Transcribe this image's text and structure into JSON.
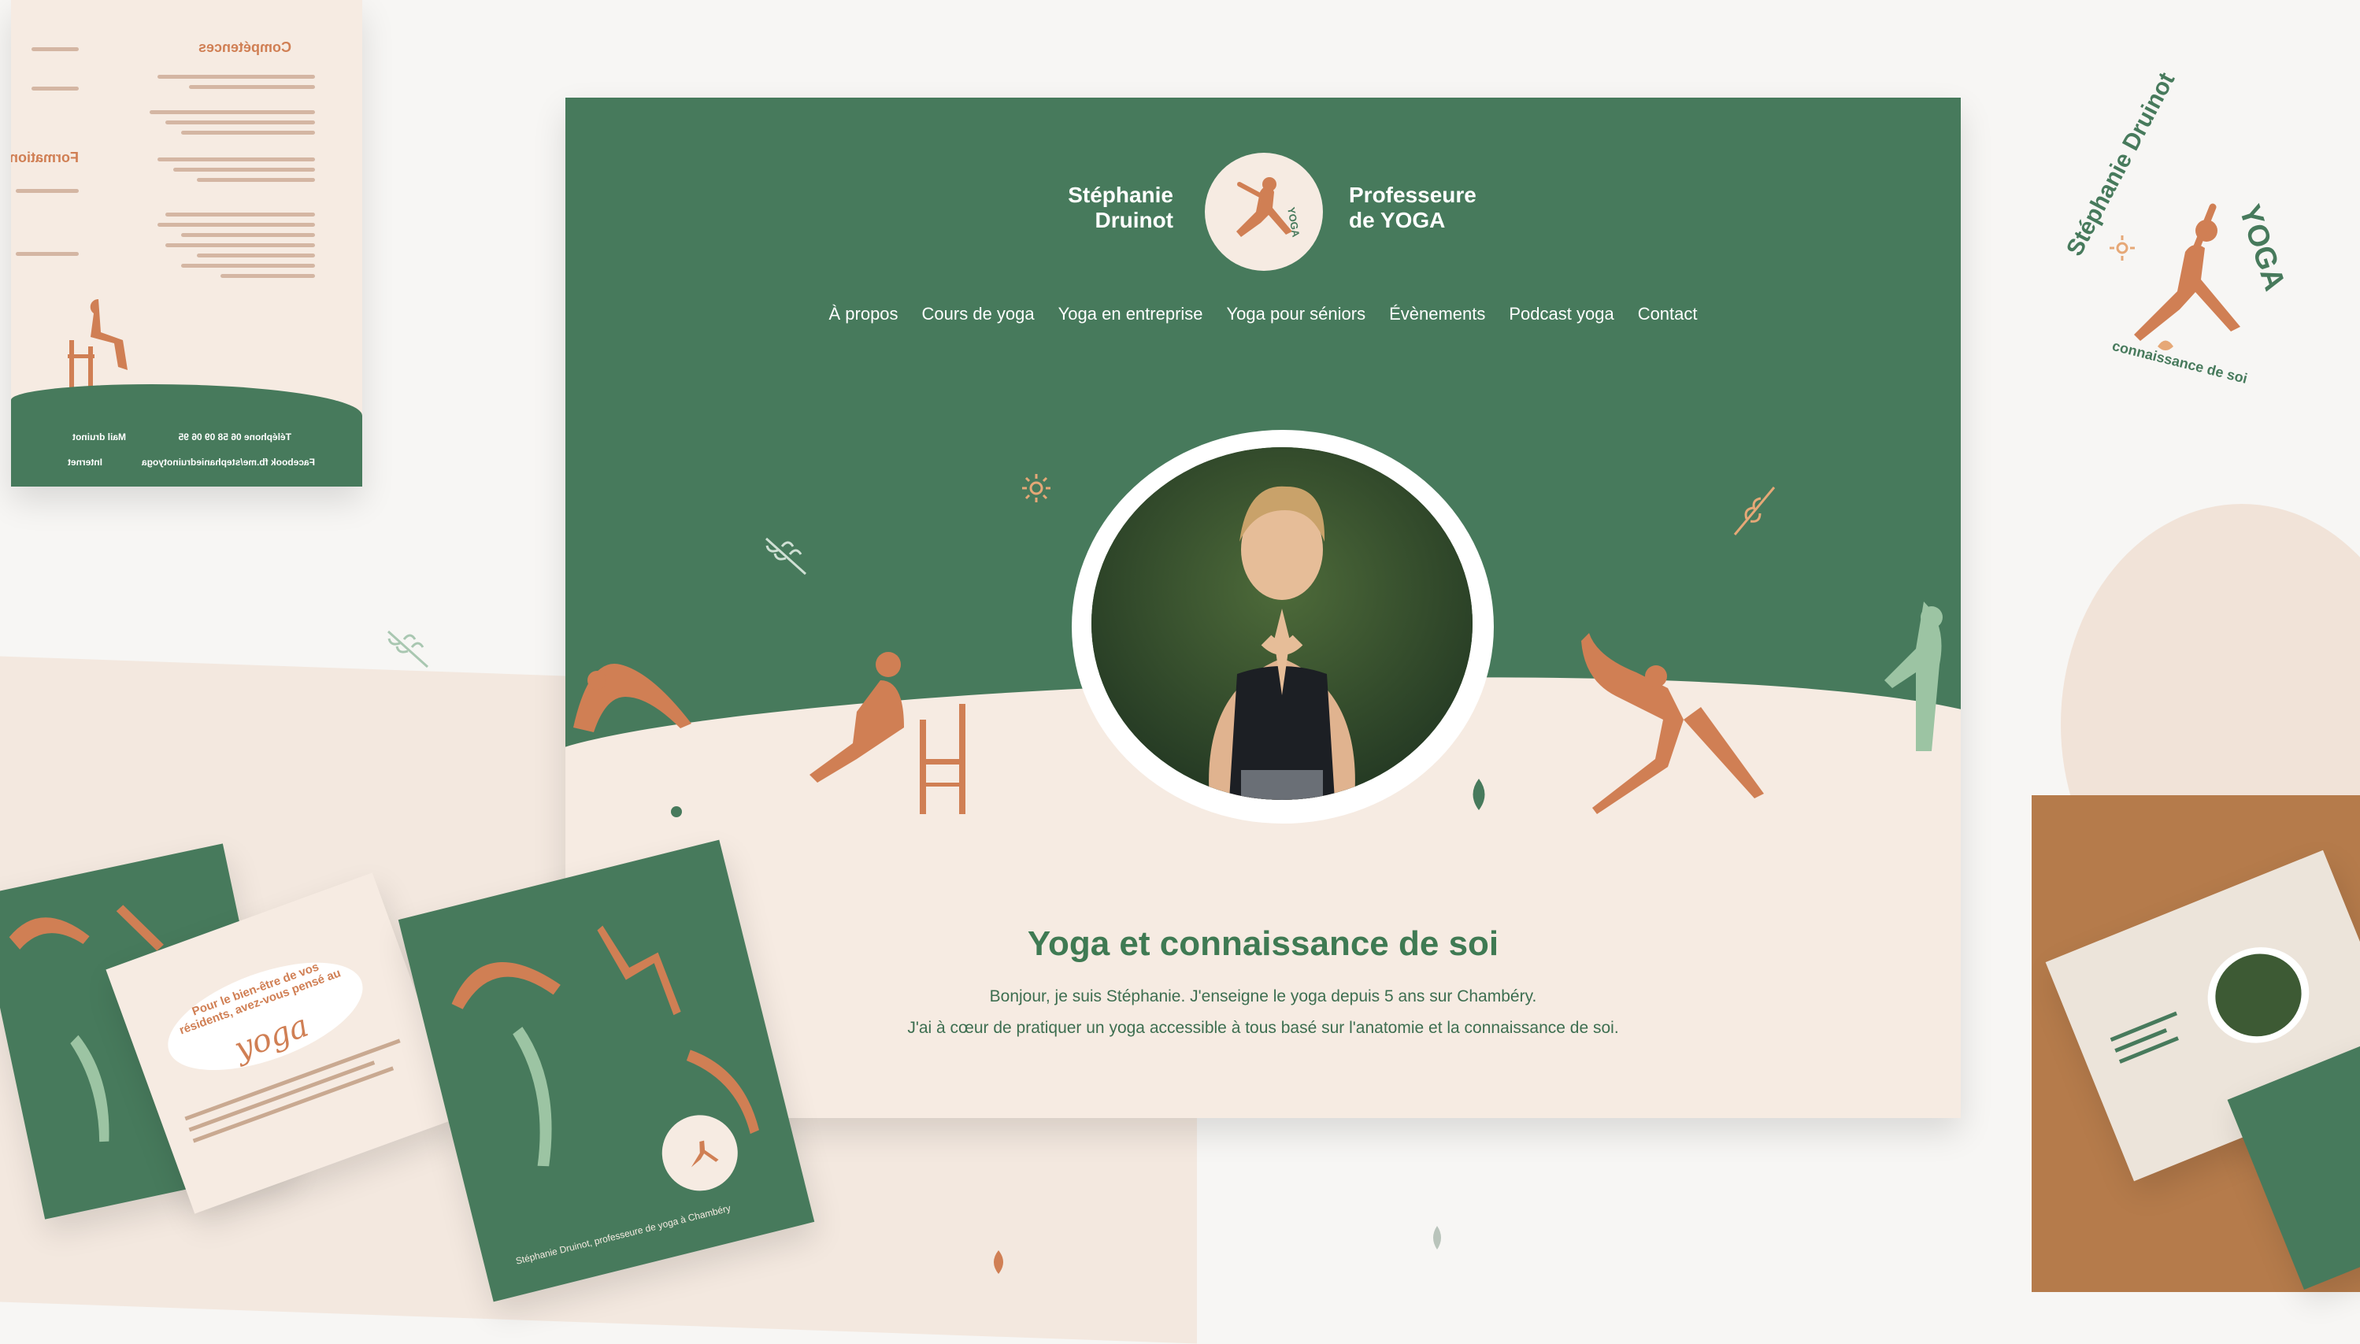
{
  "site": {
    "brand_first": "Stéphanie",
    "brand_last": "Druinot",
    "brand_role_1": "Professeure",
    "brand_role_2": "de YOGA",
    "nav": [
      "À propos",
      "Cours de yoga",
      "Yoga en entreprise",
      "Yoga pour séniors",
      "Évènements",
      "Podcast yoga",
      "Contact"
    ],
    "hero_title": "Yoga et connaissance de soi",
    "hero_line_1": "Bonjour, je suis Stéphanie. J'enseigne le yoga depuis 5 ans sur Chambéry.",
    "hero_line_2": "J'ai à cœur de pratiquer un yoga accessible à tous basé sur l'anatomie et la connaissance de soi."
  },
  "badge": {
    "name": "Stéphanie Druinot",
    "word": "YOGA",
    "tagline": "connaissance de soi"
  },
  "resume": {
    "section_1": "Compétences",
    "section_2": "Formation",
    "footer_1": "Téléphone 06 58 09 06 95",
    "footer_2": "Mail druinot",
    "footer_3": "Facebook fb.me/stephaniedruinotyoga",
    "footer_4": "Internet"
  },
  "flyer": {
    "question": "Pour le bien-être de vos résidents, avez-vous pensé au",
    "word": "yoga",
    "signature": "Stéphanie Druinot, professeure de yoga à Chambéry"
  },
  "colors": {
    "green": "#477a5c",
    "terracotta": "#d07f54",
    "cream": "#f6ebe2",
    "sage": "#9cc4a3"
  }
}
